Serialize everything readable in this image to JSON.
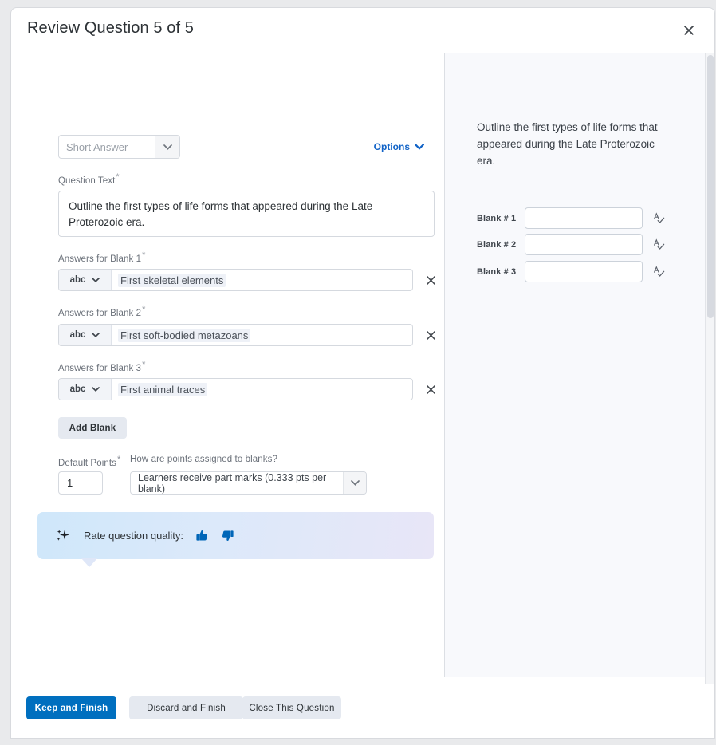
{
  "dialog": {
    "title": "Review Question 5 of 5",
    "close_icon": "close-icon"
  },
  "editor": {
    "question_type": {
      "value": "Short Answer",
      "caret_icon": "chevron-down-icon"
    },
    "options_link": {
      "label": "Options",
      "caret_icon": "chevron-down-icon"
    },
    "question_text": {
      "label": "Question Text",
      "required_marker": "*",
      "value": "Outline the first types of life forms that appeared during the Late Proterozoic era."
    },
    "answers": [
      {
        "label": "Answers for Blank 1",
        "required_marker": "*",
        "match_type": "abc",
        "value": "First skeletal elements",
        "delete_icon": "close-icon"
      },
      {
        "label": "Answers for Blank 2",
        "required_marker": "*",
        "match_type": "abc",
        "value": "First soft-bodied metazoans",
        "delete_icon": "close-icon"
      },
      {
        "label": "Answers for Blank 3",
        "required_marker": "*",
        "match_type": "abc",
        "value": "First animal traces",
        "delete_icon": "close-icon"
      }
    ],
    "add_blank_label": "Add Blank",
    "default_points": {
      "label": "Default Points",
      "required_marker": "*",
      "value": "1"
    },
    "points_assignment": {
      "label": "How are points assigned to blanks?",
      "value": "Learners receive part marks (0.333 pts per blank)",
      "caret_icon": "chevron-down-icon"
    },
    "rate_panel": {
      "sparkle_icon": "sparkle-icon",
      "label": "Rate question quality:",
      "thumbs_up_icon": "thumbs-up-icon",
      "thumbs_down_icon": "thumbs-down-icon"
    }
  },
  "preview": {
    "question_text": "Outline the first types of life forms that appeared during the Late Proterozoic era.",
    "blanks": [
      {
        "label": "Blank # 1",
        "value": "",
        "spellcheck_icon": "spellcheck-icon"
      },
      {
        "label": "Blank # 2",
        "value": "",
        "spellcheck_icon": "spellcheck-icon"
      },
      {
        "label": "Blank # 3",
        "value": "",
        "spellcheck_icon": "spellcheck-icon"
      }
    ]
  },
  "footer": {
    "keep_label": "Keep and Finish",
    "discard_label": "Discard and Finish",
    "close_question_label": "Close This Question"
  },
  "colors": {
    "primary": "#006fbf",
    "link": "#1163c7",
    "secondary_button": "#e5e9f0",
    "panel_gradient_start": "#cfe7fa",
    "panel_gradient_end": "#e8e6f7"
  }
}
